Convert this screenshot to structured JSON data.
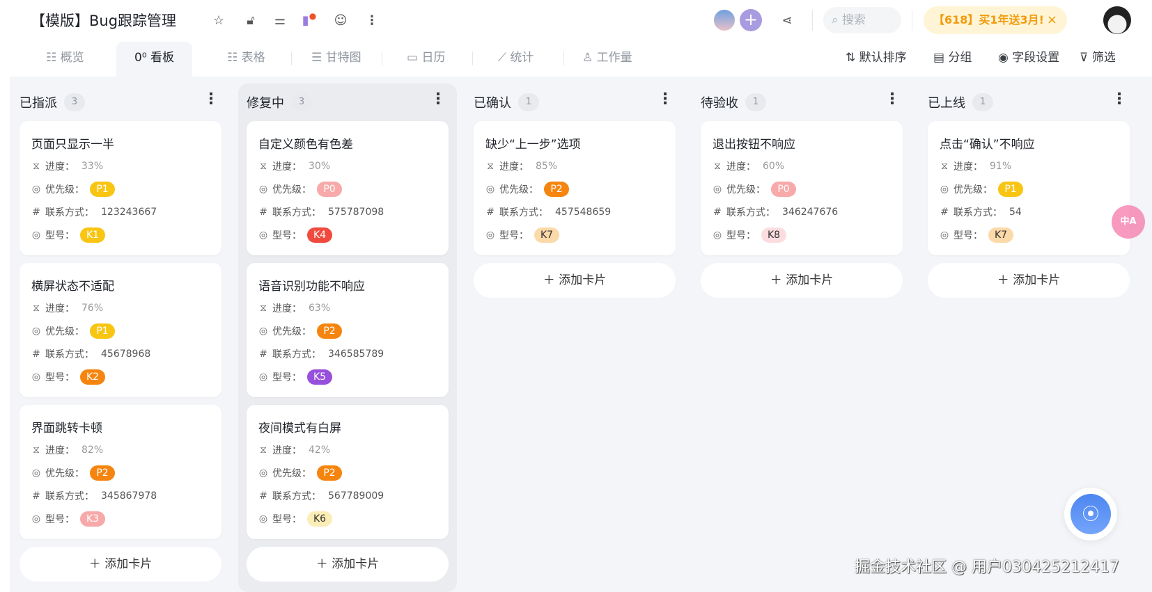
{
  "header": {
    "title": "【模版】Bug跟踪管理",
    "search_placeholder": "搜索",
    "promo": "【618】买1年送3月!",
    "promo_close": "×",
    "add": "+"
  },
  "tabs": [
    {
      "label": "概览",
      "icon": "☷"
    },
    {
      "label": "看板",
      "icon": "0⁰"
    },
    {
      "label": "表格",
      "icon": "☷"
    },
    {
      "label": "甘特图",
      "icon": "☰"
    },
    {
      "label": "日历",
      "icon": "▭"
    },
    {
      "label": "统计",
      "icon": "⟋"
    },
    {
      "label": "工作量",
      "icon": "♙"
    }
  ],
  "tools": [
    {
      "label": "默认排序",
      "icon": "⇅"
    },
    {
      "label": "分组",
      "icon": "▤"
    },
    {
      "label": "字段设置",
      "icon": "◉"
    },
    {
      "label": "筛选",
      "icon": "⊽"
    }
  ],
  "labels": {
    "progress": "进度：",
    "priority": "优先级：",
    "contact": "联系方式：",
    "model": "型号：",
    "add_card": "＋ 添加卡片"
  },
  "badge_colors": {
    "P0": [
      "#f8a9a9",
      "#fff"
    ],
    "P1": [
      "#f9c513",
      "#fff"
    ],
    "P2": [
      "#f5850f",
      "#fff"
    ],
    "K1": [
      "#f9c513",
      "#fff"
    ],
    "K2": [
      "#f5850f",
      "#fff"
    ],
    "K3": [
      "#f7a9a9",
      "#fff"
    ],
    "K4": [
      "#f04a3e",
      "#fff"
    ],
    "K5": [
      "#9750dc",
      "#fff"
    ],
    "K6": [
      "#fbedb5",
      "#333"
    ],
    "K7": [
      "#fcd9a8",
      "#333"
    ],
    "K8": [
      "#fbdde0",
      "#333"
    ]
  },
  "columns": [
    {
      "name": "已指派",
      "count": "3",
      "cards": [
        {
          "title": "页面只显示一半",
          "progress": "33%",
          "priority": "P1",
          "contact": "123243667",
          "model": "K1"
        },
        {
          "title": "横屏状态不适配",
          "progress": "76%",
          "priority": "P1",
          "contact": "45678968",
          "model": "K2"
        },
        {
          "title": "界面跳转卡顿",
          "progress": "82%",
          "priority": "P2",
          "contact": "345867978",
          "model": "K3"
        }
      ]
    },
    {
      "name": "修复中",
      "count": "3",
      "cards": [
        {
          "title": "自定义颜色有色差",
          "progress": "30%",
          "priority": "P0",
          "contact": "575787098",
          "model": "K4"
        },
        {
          "title": "语音识别功能不响应",
          "progress": "63%",
          "priority": "P2",
          "contact": "346585789",
          "model": "K5"
        },
        {
          "title": "夜间模式有白屏",
          "progress": "42%",
          "priority": "P2",
          "contact": "567789009",
          "model": "K6"
        }
      ]
    },
    {
      "name": "已确认",
      "count": "1",
      "cards": [
        {
          "title": "缺少“上一步”选项",
          "progress": "85%",
          "priority": "P2",
          "contact": "457548659",
          "model": "K7"
        }
      ]
    },
    {
      "name": "待验收",
      "count": "1",
      "cards": [
        {
          "title": "退出按钮不响应",
          "progress": "60%",
          "priority": "P0",
          "contact": "346247676",
          "model": "K8"
        }
      ]
    },
    {
      "name": "已上线",
      "count": "1",
      "cards": [
        {
          "title": "点击“确认”不响应",
          "progress": "91%",
          "priority": "P1",
          "contact": "54",
          "model": "K7"
        }
      ]
    }
  ],
  "fab_icon": "⦿",
  "translate_badge": "中A",
  "watermark": "掘金技术社区 @ 用户030425212417"
}
